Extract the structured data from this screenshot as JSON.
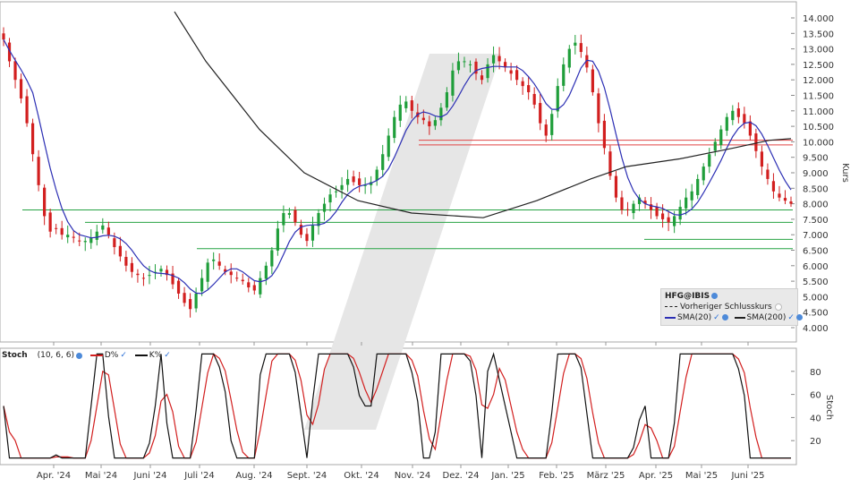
{
  "chart_data": [
    {
      "type": "candlestick",
      "instrument": "HFG@IBIS",
      "ylabel": "Kurs",
      "ylim": [
        4.0,
        14.0
      ],
      "y_ticks": [
        "14.000",
        "13.500",
        "13.000",
        "12.500",
        "12.000",
        "11.500",
        "11.000",
        "10.500",
        "10.000",
        "9.500",
        "9.000",
        "8.500",
        "8.000",
        "7.500",
        "7.000",
        "6.500",
        "6.000",
        "5.500",
        "5.000",
        "4.500",
        "4.000"
      ],
      "x_tick_labels": [
        "Apr. '24",
        "Mai '24",
        "Juni '24",
        "Juli '24",
        "Aug. '24",
        "Sept. '24",
        "Okt. '24",
        "Nov. '24",
        "Dez. '24",
        "Jan. '25",
        "Feb. '25",
        "März '25",
        "Apr. '25",
        "Mai '25",
        "Juni '25"
      ],
      "horizontal_lines": {
        "green": [
          7.8,
          7.4,
          6.85,
          6.55
        ],
        "red": [
          10.05,
          9.9
        ]
      },
      "legend": {
        "title": "HFG@IBIS",
        "items": [
          "Vorheriger Schlusskurs",
          "SMA(20)",
          "SMA(200)"
        ]
      },
      "series": [
        {
          "name": "Price",
          "color_up": "#1f9e3a",
          "color_down": "#d21f1f",
          "close": [
            13.3,
            12.6,
            12.0,
            11.4,
            10.6,
            9.6,
            8.6,
            7.6,
            7.1,
            7.2,
            7.0,
            7.0,
            6.9,
            6.8,
            6.8,
            6.9,
            7.1,
            7.3,
            7.0,
            6.6,
            6.3,
            6.0,
            5.8,
            5.7,
            5.6,
            5.7,
            5.8,
            5.9,
            5.7,
            5.4,
            5.1,
            4.8,
            4.6,
            5.1,
            5.6,
            6.1,
            6.2,
            6.0,
            5.8,
            5.7,
            5.6,
            5.5,
            5.3,
            5.2,
            5.6,
            6.0,
            6.5,
            7.2,
            7.7,
            7.7,
            7.4,
            7.0,
            6.8,
            7.3,
            7.7,
            8.0,
            8.3,
            8.4,
            8.6,
            8.8,
            8.7,
            8.6,
            8.6,
            8.7,
            9.1,
            9.6,
            10.2,
            10.8,
            11.2,
            11.3,
            11.0,
            10.8,
            10.7,
            10.5,
            10.7,
            11.1,
            11.6,
            12.3,
            12.6,
            12.6,
            12.5,
            12.2,
            12.0,
            12.5,
            12.8,
            12.6,
            12.4,
            12.2,
            12.0,
            11.8,
            11.6,
            11.2,
            10.6,
            10.2,
            10.9,
            11.8,
            12.5,
            13.0,
            13.2,
            12.9,
            12.4,
            11.6,
            10.6,
            9.8,
            8.9,
            8.2,
            7.8,
            7.8,
            8.0,
            8.2,
            8.0,
            7.8,
            7.6,
            7.5,
            7.4,
            7.6,
            7.9,
            8.2,
            8.4,
            8.8,
            9.2,
            9.6,
            10.0,
            10.4,
            10.8,
            11.0,
            10.8,
            10.6,
            10.2,
            9.7,
            9.2,
            8.8,
            8.4,
            8.2,
            8.1,
            8.0
          ]
        },
        {
          "name": "SMA(20)",
          "color": "#2c2fb4"
        },
        {
          "name": "SMA(200)",
          "color": "#222222"
        }
      ]
    },
    {
      "type": "line",
      "indicator": "Stoch",
      "params": "(10, 6, 6)",
      "ylabel": "Stoch",
      "ylim": [
        0,
        100
      ],
      "y_ticks": [
        "80",
        "60",
        "40",
        "20"
      ],
      "series": [
        {
          "name": "D%",
          "color": "#d21f1f"
        },
        {
          "name": "K%",
          "color": "#111111"
        }
      ]
    }
  ]
}
